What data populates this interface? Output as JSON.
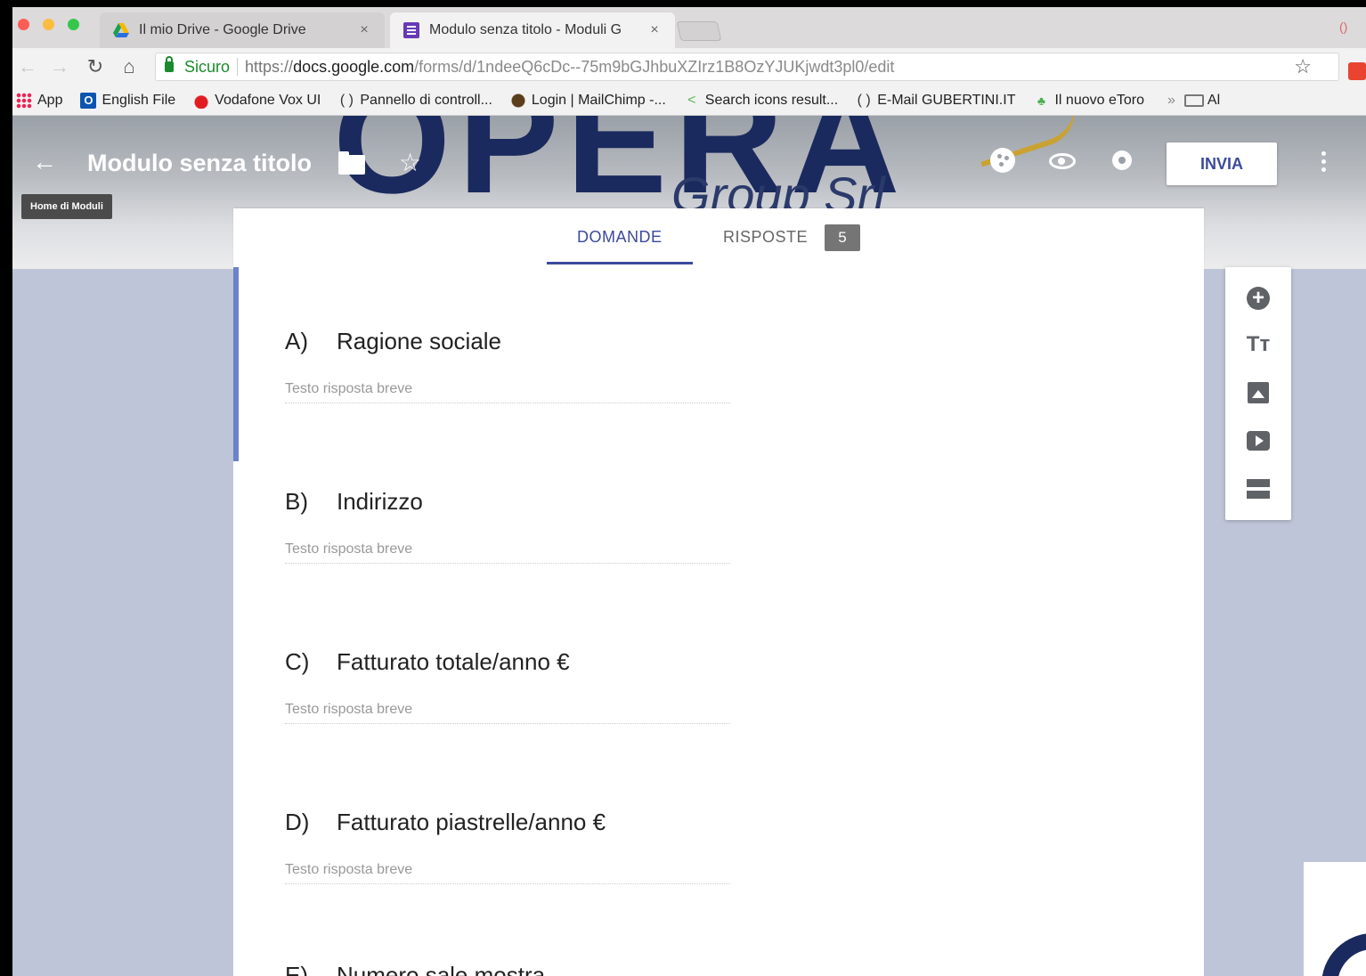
{
  "browser": {
    "tabs": [
      {
        "title": "Il mio Drive - Google Drive",
        "icon": "google-drive-icon"
      },
      {
        "title": "Modulo senza titolo - Moduli G",
        "icon": "google-forms-icon"
      }
    ],
    "omnibox": {
      "secure_label": "Sicuro",
      "url_prefix": "https://",
      "url_host": "docs.google.com",
      "url_path": "/forms/d/1ndeeQ6cDc--75m9bGJhbuXZIrz1B8OzYJUKjwdt3pl0/edit"
    },
    "bookmarks": [
      {
        "label": "App",
        "icon": "apps-grid-icon"
      },
      {
        "label": "English File",
        "icon": "oxford-icon"
      },
      {
        "label": "Vodafone Vox UI",
        "icon": "vodafone-icon"
      },
      {
        "label": "Pannello di controll...",
        "icon": "page-icon"
      },
      {
        "label": "Login | MailChimp -...",
        "icon": "mailchimp-icon"
      },
      {
        "label": "Search icons result...",
        "icon": "share-icon"
      },
      {
        "label": "E-Mail GUBERTINI.IT",
        "icon": "page-icon"
      },
      {
        "label": "Il nuovo eToro",
        "icon": "etoro-icon"
      }
    ],
    "bookmarks_more": "»",
    "bookmarks_folder": "Al"
  },
  "forms": {
    "header": {
      "title": "Modulo senza titolo",
      "home_chip": "Home di Moduli",
      "send_button": "INVIA",
      "banner_text": "OPERA",
      "banner_sub": "Group Srl"
    },
    "tabs": {
      "questions": "DOMANDE",
      "responses": "RISPOSTE",
      "responses_count": "5"
    },
    "questions": [
      {
        "letter": "A)",
        "text": "Ragione sociale",
        "placeholder": "Testo risposta breve"
      },
      {
        "letter": "B)",
        "text": "Indirizzo",
        "placeholder": "Testo risposta breve"
      },
      {
        "letter": "C)",
        "text": "Fatturato totale/anno  €",
        "placeholder": "Testo risposta breve"
      },
      {
        "letter": "D)",
        "text": "Fatturato piastrelle/anno   €",
        "placeholder": "Testo risposta breve"
      },
      {
        "letter": "E)",
        "text": "Numero sale mostra",
        "placeholder": ""
      }
    ],
    "side_tools": {
      "title_glyph": "Tт"
    }
  },
  "colors": {
    "accent": "#3c4a9c",
    "focus_bar": "#6a84c9",
    "page_bg": "#bfc5d8"
  }
}
